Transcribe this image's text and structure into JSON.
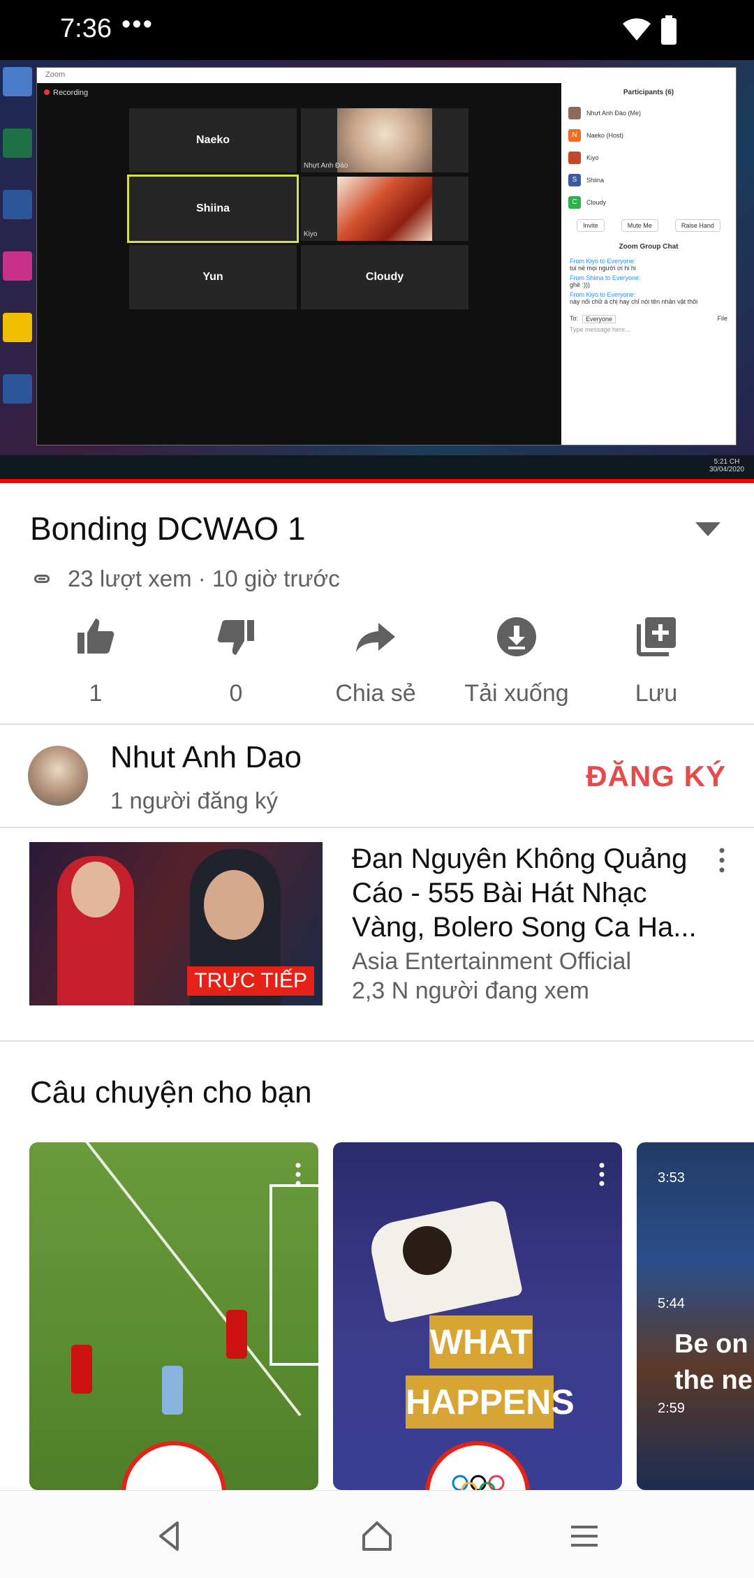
{
  "status_bar": {
    "time": "7:36",
    "more": "•••"
  },
  "player": {
    "zoom_window_title": "Zoom",
    "recording_label": "Recording",
    "tiles": [
      {
        "name": "Naeko"
      },
      {
        "name": "",
        "caption": "Nhựt Anh Đào"
      },
      {
        "name": "Shiina"
      },
      {
        "name": "",
        "caption": "Kiyo"
      },
      {
        "name": "Yun"
      },
      {
        "name": "Cloudy"
      }
    ],
    "participants_header": "Participants (6)",
    "participants": [
      {
        "initial": "",
        "name": "Nhựt Anh Đào (Me)",
        "color": "#8a6a5a"
      },
      {
        "initial": "N",
        "name": "Naeko (Host)",
        "color": "#f26d21"
      },
      {
        "initial": "",
        "name": "Kiyo",
        "color": "#c24a2a"
      },
      {
        "initial": "S",
        "name": "Shiina",
        "color": "#3b5aa0"
      },
      {
        "initial": "C",
        "name": "Cloudy",
        "color": "#2bb24c"
      }
    ],
    "panel_buttons": [
      "Invite",
      "Mute Me",
      "Raise Hand"
    ],
    "chat_header": "Zoom Group Chat",
    "chat": [
      {
        "from": "From Kiyo to Everyone:",
        "text": "tui nè mọi người ơi hi hi"
      },
      {
        "from": "From Shiina to Everyone:",
        "text": "ghê :)))"
      },
      {
        "from": "From Kiyo to Everyone:",
        "text": "này nối chữ á chị hay chỉ nói tên nhân vật thôi"
      }
    ],
    "chat_to_label": "To:",
    "chat_to_value": "Everyone",
    "chat_file_label": "File",
    "chat_placeholder": "Type message here...",
    "clock_time": "5:21 CH",
    "clock_date": "30/04/2020",
    "progress_fraction": 1.0
  },
  "video": {
    "title": "Bonding DCWAO 1",
    "views": "23 lượt xem · 10 giờ trước"
  },
  "actions": {
    "like_count": "1",
    "dislike_count": "0",
    "share_label": "Chia sẻ",
    "download_label": "Tải xuống",
    "save_label": "Lưu"
  },
  "channel": {
    "name": "Nhut Anh Dao",
    "subscribers": "1 người đăng ký",
    "subscribe_label": "ĐĂNG KÝ"
  },
  "recommended": {
    "title": "Đan Nguyên Không Quảng Cáo - 555 Bài Hát Nhạc Vàng, Bolero Song Ca Ha...",
    "channel": "Asia Entertainment Official",
    "viewers": "2,3 N người đang xem",
    "live_badge": "TRỰC TIẾP"
  },
  "stories": {
    "title": "Câu chuyện cho bạn",
    "card2_text_1": "WHAT",
    "card2_text_2": "HAPPENS",
    "card3_text_1": "Be on",
    "card3_text_2": "the ne",
    "card3_times": [
      "3:53",
      "5:44",
      "2:59"
    ]
  },
  "colors": {
    "subscribe": "#e64a4a",
    "live": "#e62117",
    "secondary_text": "#606060"
  }
}
